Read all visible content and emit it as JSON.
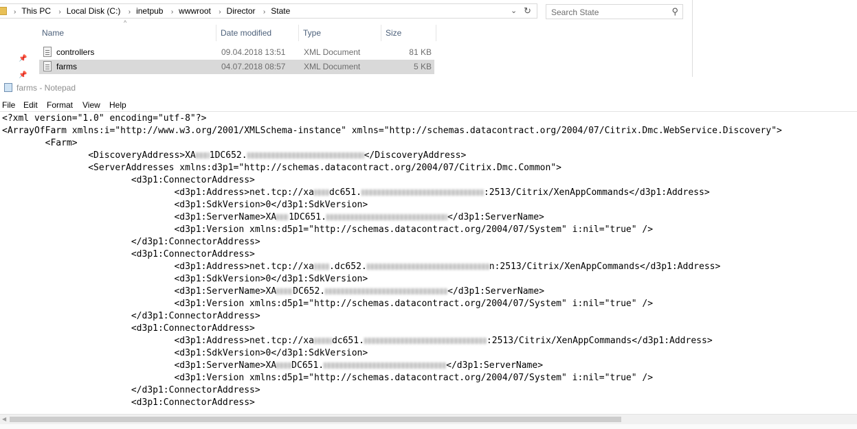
{
  "explorer": {
    "breadcrumb": [
      "This PC",
      "Local Disk (C:)",
      "inetpub",
      "wwwroot",
      "Director",
      "State"
    ],
    "search_placeholder": "Search State",
    "columns": [
      "Name",
      "Date modified",
      "Type",
      "Size"
    ],
    "files": [
      {
        "name": "controllers",
        "date": "09.04.2018 13:51",
        "type": "XML Document",
        "size": "81 KB",
        "selected": false
      },
      {
        "name": "farms",
        "date": "04.07.2018 08:57",
        "type": "XML Document",
        "size": "5 KB",
        "selected": true
      }
    ]
  },
  "notepad": {
    "title": "farms - Notepad",
    "menu": [
      "File",
      "Edit",
      "Format",
      "View",
      "Help"
    ],
    "lines": [
      "<?xml version=\"1.0\" encoding=\"utf-8\"?>",
      "<ArrayOfFarm xmlns:i=\"http://www.w3.org/2001/XMLSchema-instance\" xmlns=\"http://schemas.datacontract.org/2004/07/Citrix.Dmc.WebService.Discovery\">",
      "\t<Farm>",
      "\t\t<DiscoveryAddress>XA{{blur:20}}1DC652.{{blur:170}}</DiscoveryAddress>",
      "\t\t<ServerAddresses xmlns:d3p1=\"http://schemas.datacontract.org/2004/07/Citrix.Dmc.Common\">",
      "\t\t\t<d3p1:ConnectorAddress>",
      "\t\t\t\t<d3p1:Address>net.tcp://xa{{blur:22}}dc651.{{blur:178}}:2513/Citrix/XenAppCommands</d3p1:Address>",
      "\t\t\t\t<d3p1:SdkVersion>0</d3p1:SdkVersion>",
      "\t\t\t\t<d3p1:ServerName>XA{{blur:18}}1DC651.{{blur:176}}</d3p1:ServerName>",
      "\t\t\t\t<d3p1:Version xmlns:d5p1=\"http://schemas.datacontract.org/2004/07/System\" i:nil=\"true\" />",
      "\t\t\t</d3p1:ConnectorAddress>",
      "\t\t\t<d3p1:ConnectorAddress>",
      "\t\t\t\t<d3p1:Address>net.tcp://xa{{blur:22}}.dc652.{{blur:178}}n:2513/Citrix/XenAppCommands</d3p1:Address>",
      "\t\t\t\t<d3p1:SdkVersion>0</d3p1:SdkVersion>",
      "\t\t\t\t<d3p1:ServerName>XA{{blur:24}}DC652.{{blur:178}}</d3p1:ServerName>",
      "\t\t\t\t<d3p1:Version xmlns:d5p1=\"http://schemas.datacontract.org/2004/07/System\" i:nil=\"true\" />",
      "\t\t\t</d3p1:ConnectorAddress>",
      "\t\t\t<d3p1:ConnectorAddress>",
      "\t\t\t\t<d3p1:Address>net.tcp://xa{{blur:26}}dc651.{{blur:178}}:2513/Citrix/XenAppCommands</d3p1:Address>",
      "\t\t\t\t<d3p1:SdkVersion>0</d3p1:SdkVersion>",
      "\t\t\t\t<d3p1:ServerName>XA{{blur:22}}DC651.{{blur:178}}</d3p1:ServerName>",
      "\t\t\t\t<d3p1:Version xmlns:d5p1=\"http://schemas.datacontract.org/2004/07/System\" i:nil=\"true\" />",
      "\t\t\t</d3p1:ConnectorAddress>",
      "\t\t\t<d3p1:ConnectorAddress>"
    ]
  }
}
